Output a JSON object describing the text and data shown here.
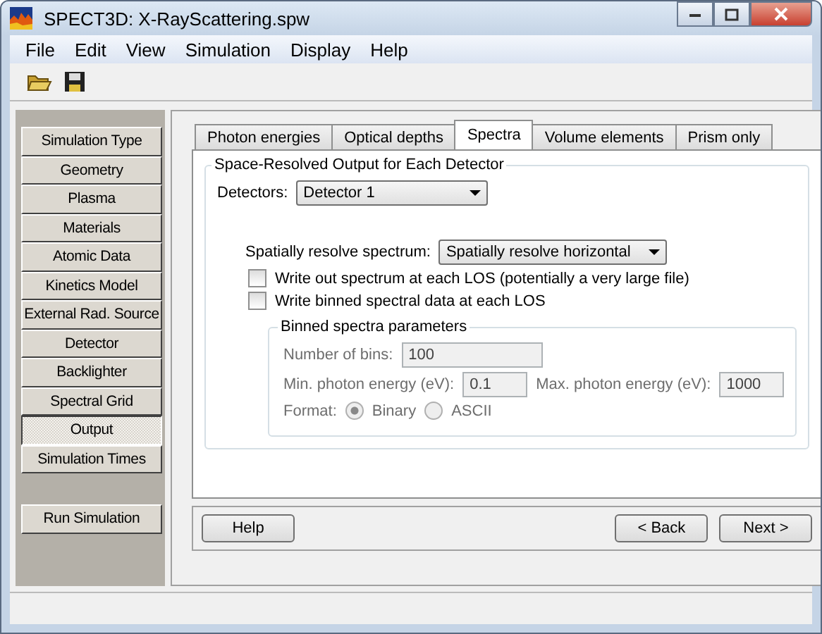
{
  "window": {
    "title": "SPECT3D:  X-RayScattering.spw"
  },
  "menu": [
    {
      "label": "File"
    },
    {
      "label": "Edit"
    },
    {
      "label": "View"
    },
    {
      "label": "Simulation"
    },
    {
      "label": "Display"
    },
    {
      "label": "Help"
    }
  ],
  "sidebar": {
    "items": [
      {
        "label": "Simulation Type",
        "selected": false
      },
      {
        "label": "Geometry",
        "selected": false
      },
      {
        "label": "Plasma",
        "selected": false
      },
      {
        "label": "Materials",
        "selected": false
      },
      {
        "label": "Atomic Data",
        "selected": false
      },
      {
        "label": "Kinetics Model",
        "selected": false
      },
      {
        "label": "External Rad. Source",
        "selected": false
      },
      {
        "label": "Detector",
        "selected": false
      },
      {
        "label": "Backlighter",
        "selected": false
      },
      {
        "label": "Spectral Grid",
        "selected": false
      },
      {
        "label": "Output",
        "selected": true
      },
      {
        "label": "Simulation Times",
        "selected": false
      }
    ],
    "run_button": "Run Simulation"
  },
  "tabs": [
    {
      "label": "Photon energies",
      "selected": false
    },
    {
      "label": "Optical depths",
      "selected": false
    },
    {
      "label": "Spectra",
      "selected": true
    },
    {
      "label": "Volume elements",
      "selected": false
    },
    {
      "label": "Prism only",
      "selected": false
    }
  ],
  "group": {
    "title": "Space-Resolved Output for Each Detector",
    "detectors": {
      "label": "Detectors:",
      "value": "Detector 1"
    },
    "resolve": {
      "label": "Spatially resolve spectrum:",
      "value": "Spatially resolve horizontal"
    },
    "checkboxes": [
      {
        "label": "Write out spectrum at each LOS (potentially a very large file)",
        "checked": false
      },
      {
        "label": "Write binned spectral data at each LOS",
        "checked": false
      }
    ],
    "binned": {
      "title": "Binned spectra parameters",
      "disabled": true,
      "bins": {
        "label": "Number of bins:",
        "value": "100"
      },
      "min": {
        "label": "Min. photon energy (eV):",
        "value": "0.1"
      },
      "max": {
        "label": "Max. photon energy (eV):",
        "value": "1000"
      },
      "format": {
        "label": "Format:",
        "options": [
          {
            "label": "Binary",
            "selected": true
          },
          {
            "label": "ASCII",
            "selected": false
          }
        ]
      }
    }
  },
  "buttons": {
    "help": "Help",
    "back": "< Back",
    "next": "Next >"
  }
}
